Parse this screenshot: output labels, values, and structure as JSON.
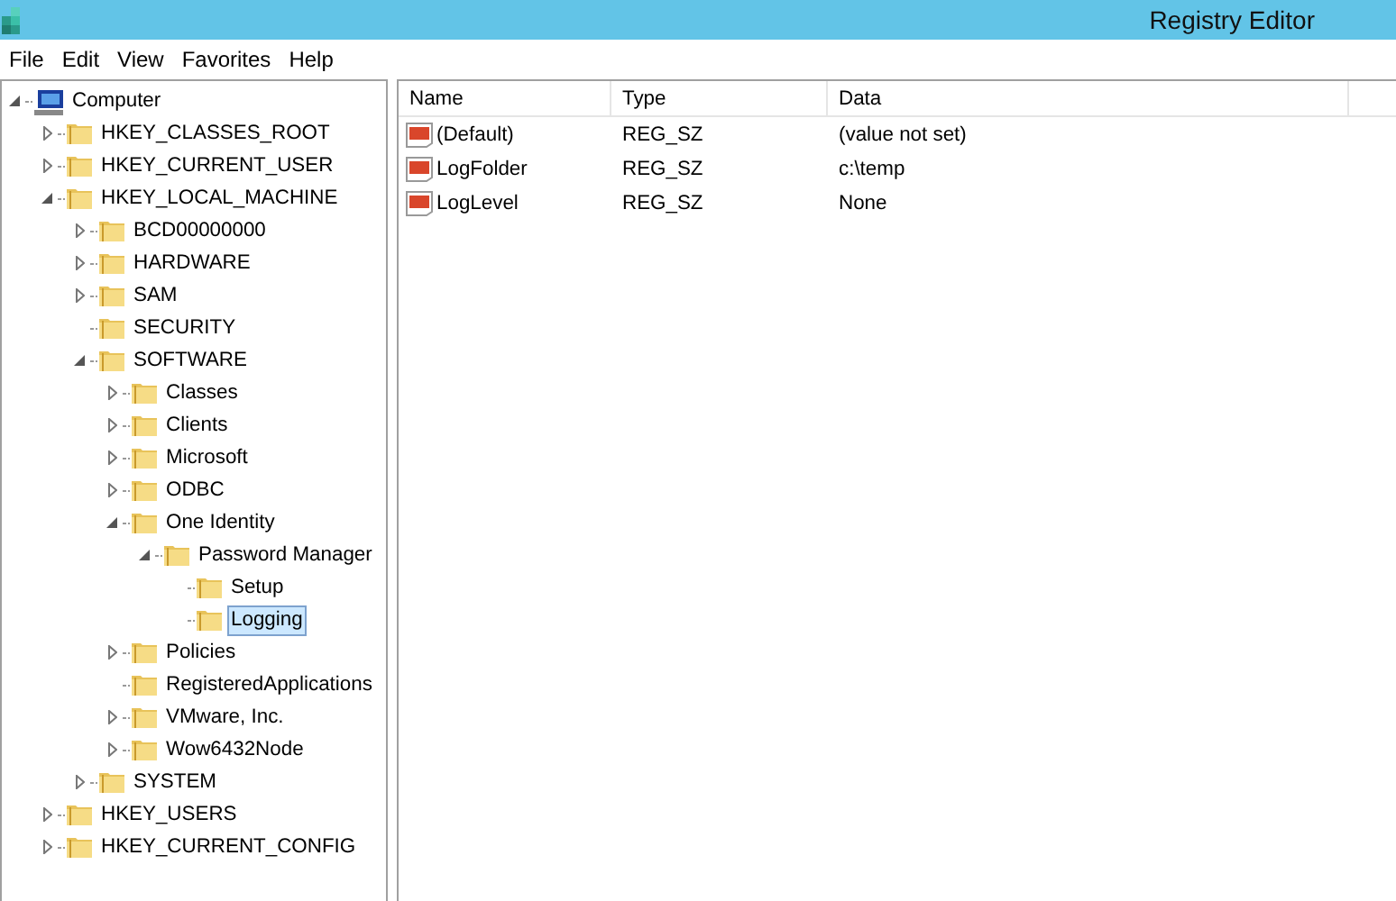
{
  "window": {
    "title": "Registry Editor"
  },
  "menu": [
    "File",
    "Edit",
    "View",
    "Favorites",
    "Help"
  ],
  "tree": [
    {
      "label": "Computer",
      "kind": "computer",
      "expanded": true,
      "selected": false,
      "children": [
        {
          "label": "HKEY_CLASSES_ROOT",
          "kind": "folder",
          "expanded": false,
          "selected": false
        },
        {
          "label": "HKEY_CURRENT_USER",
          "kind": "folder",
          "expanded": false,
          "selected": false
        },
        {
          "label": "HKEY_LOCAL_MACHINE",
          "kind": "folder",
          "expanded": true,
          "selected": false,
          "children": [
            {
              "label": "BCD00000000",
              "kind": "folder",
              "expanded": false,
              "selected": false
            },
            {
              "label": "HARDWARE",
              "kind": "folder",
              "expanded": false,
              "selected": false
            },
            {
              "label": "SAM",
              "kind": "folder",
              "expanded": false,
              "selected": false
            },
            {
              "label": "SECURITY",
              "kind": "folder",
              "selected": false
            },
            {
              "label": "SOFTWARE",
              "kind": "folder",
              "expanded": true,
              "selected": false,
              "children": [
                {
                  "label": "Classes",
                  "kind": "folder",
                  "expanded": false,
                  "selected": false
                },
                {
                  "label": "Clients",
                  "kind": "folder",
                  "expanded": false,
                  "selected": false
                },
                {
                  "label": "Microsoft",
                  "kind": "folder",
                  "expanded": false,
                  "selected": false
                },
                {
                  "label": "ODBC",
                  "kind": "folder",
                  "expanded": false,
                  "selected": false
                },
                {
                  "label": "One Identity",
                  "kind": "folder",
                  "expanded": true,
                  "selected": false,
                  "children": [
                    {
                      "label": "Password Manager",
                      "kind": "folder",
                      "expanded": true,
                      "selected": false,
                      "children": [
                        {
                          "label": "Setup",
                          "kind": "folder",
                          "selected": false
                        },
                        {
                          "label": "Logging",
                          "kind": "folder",
                          "selected": true
                        }
                      ]
                    }
                  ]
                },
                {
                  "label": "Policies",
                  "kind": "folder",
                  "expanded": false,
                  "selected": false
                },
                {
                  "label": "RegisteredApplications",
                  "kind": "folder",
                  "selected": false
                },
                {
                  "label": "VMware, Inc.",
                  "kind": "folder",
                  "expanded": false,
                  "selected": false
                },
                {
                  "label": "Wow6432Node",
                  "kind": "folder",
                  "expanded": false,
                  "selected": false
                }
              ]
            },
            {
              "label": "SYSTEM",
              "kind": "folder",
              "expanded": false,
              "selected": false
            }
          ]
        },
        {
          "label": "HKEY_USERS",
          "kind": "folder",
          "expanded": false,
          "selected": false
        },
        {
          "label": "HKEY_CURRENT_CONFIG",
          "kind": "folder",
          "expanded": false,
          "selected": false
        }
      ]
    }
  ],
  "table": {
    "columns": [
      "Name",
      "Type",
      "Data"
    ],
    "rows": [
      {
        "name": "(Default)",
        "type": "REG_SZ",
        "data": "(value not set)"
      },
      {
        "name": "LogFolder",
        "type": "REG_SZ",
        "data": "c:\\temp"
      },
      {
        "name": "LogLevel",
        "type": "REG_SZ",
        "data": "None"
      }
    ]
  }
}
